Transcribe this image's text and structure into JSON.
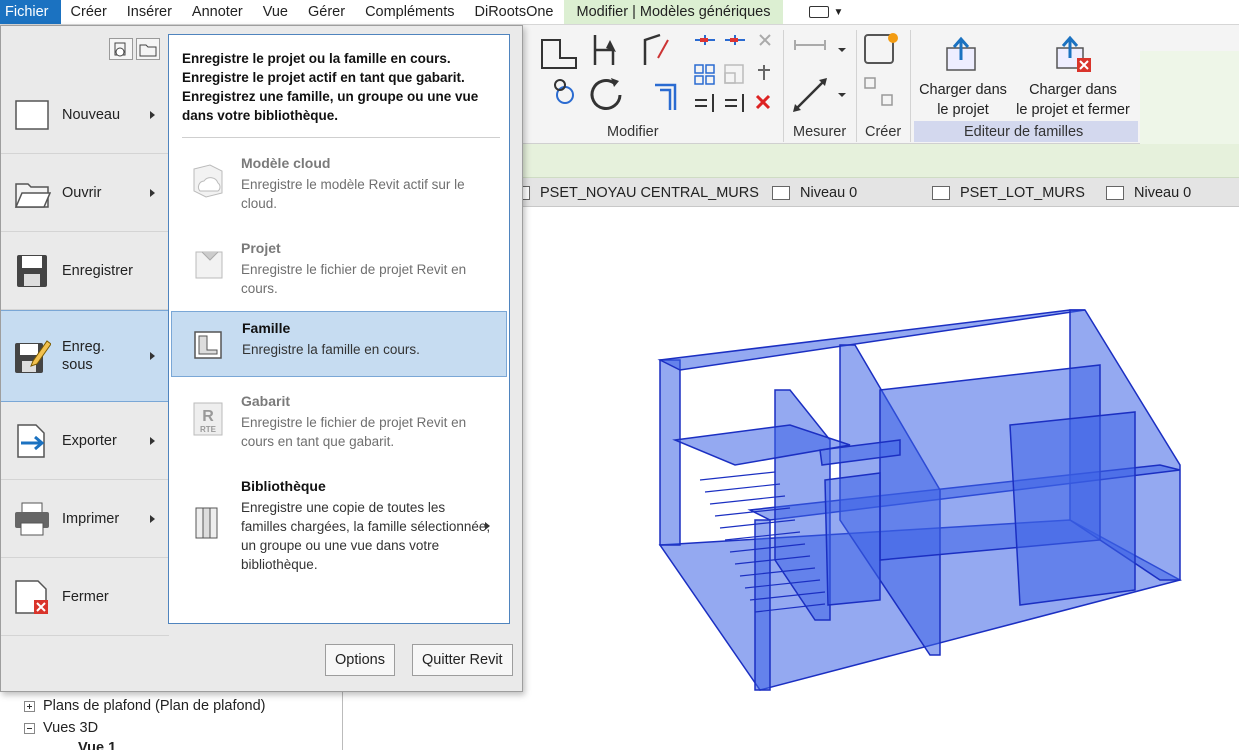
{
  "menubar": {
    "tabs": [
      "Fichier",
      "Créer",
      "Insérer",
      "Annoter",
      "Vue",
      "Gérer",
      "Compléments",
      "DiRootsOne"
    ],
    "context_tab": "Modifier | Modèles génériques"
  },
  "ribbon": {
    "panels": {
      "modifier": "Modifier",
      "mesurer": "Mesurer",
      "creer": "Créer",
      "editeur": "Editeur de familles"
    },
    "load_project": [
      "Charger dans",
      "le projet"
    ],
    "load_close": [
      "Charger dans",
      "le projet et fermer"
    ]
  },
  "viewtabs": [
    "PSET_NOYAU CENTRAL_MURS",
    "Niveau 0",
    "PSET_LOT_MURS",
    "Niveau 0"
  ],
  "browser": {
    "rows": [
      "Plans de plafond (Plan de plafond)",
      "Vues 3D",
      "Vue 1"
    ]
  },
  "appmenu": {
    "left_items": [
      {
        "label": "Nouveau",
        "icon": "new-document-icon"
      },
      {
        "label": "Ouvrir",
        "icon": "open-folder-icon"
      },
      {
        "label": "Enregistrer",
        "icon": "save-icon"
      },
      {
        "label": "Enreg.\nsous",
        "icon": "save-as-icon"
      },
      {
        "label": "Exporter",
        "icon": "export-icon"
      },
      {
        "label": "Imprimer",
        "icon": "printer-icon"
      },
      {
        "label": "Fermer",
        "icon": "close-document-icon"
      }
    ],
    "submenu": {
      "header": "Enregistre le projet ou la famille en cours. Enregistre le projet actif en tant que gabarit. Enregistrez une famille, un groupe ou une vue dans votre bibliothèque.",
      "items": [
        {
          "title": "Modèle cloud",
          "desc": "Enregistre le modèle Revit actif sur le cloud."
        },
        {
          "title": "Projet",
          "desc": "Enregistre le fichier de projet Revit en cours."
        },
        {
          "title": "Famille",
          "desc": "Enregistre la famille en cours."
        },
        {
          "title": "Gabarit",
          "desc": "Enregistre le fichier de projet Revit en cours en tant que gabarit."
        },
        {
          "title": "Bibliothèque",
          "desc": "Enregistre une copie de toutes les familles chargées, la famille sélectionnée, un groupe ou une vue dans votre bibliothèque."
        }
      ],
      "rte": "RTE"
    },
    "options_label": "Options",
    "quit_label": "Quitter Revit"
  },
  "colors": {
    "file_tab": "#1b72c1",
    "context_tab": "#dcefd2",
    "selection": "#c6dcf1",
    "model_fill": "#3d63e6"
  }
}
